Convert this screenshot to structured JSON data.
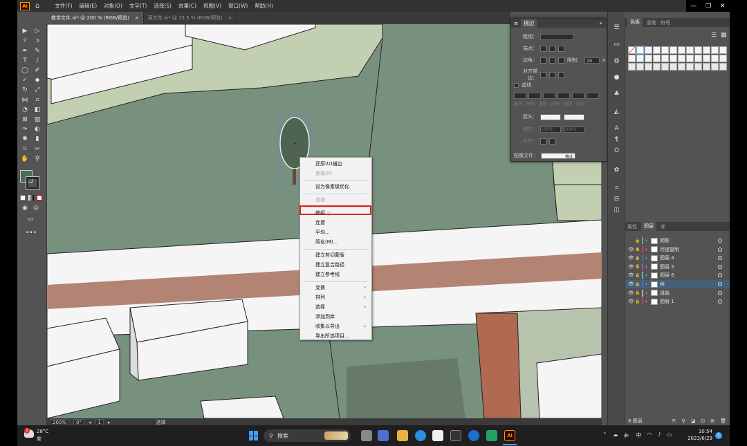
{
  "menubar": {
    "app_logo": "Ai",
    "menus": [
      "文件(F)",
      "编辑(E)",
      "对象(O)",
      "文字(T)",
      "选择(S)",
      "效果(C)",
      "视图(V)",
      "窗口(W)",
      "帮助(H)"
    ]
  },
  "tabs": [
    {
      "label": "教学文件.ai* @ 200 % (RGB/预览)",
      "close": "×"
    },
    {
      "label": "源文件.ai* @ 12.5 % (RGB/预览)",
      "close": "×"
    }
  ],
  "stroke_panel": {
    "title": "描边",
    "weight_label": "粗细：",
    "cap_label": "端点：",
    "corner_label": "边角：",
    "limit_label": "限制：",
    "limit_value": "10",
    "limit_unit": "x",
    "align_label": "对齐描边：",
    "dashed_label": "虚线",
    "dash_labels": [
      "虚线",
      "间隙",
      "虚线",
      "间隙",
      "虚线",
      "间隙"
    ],
    "arrow_label": "箭头：",
    "scale_label": "缩放：",
    "scale_values": [
      "100%",
      "100%"
    ],
    "align2_label": "对齐：",
    "profile_label": "配置文件：",
    "profile_value": "等比"
  },
  "swatches_panel": {
    "tabs": [
      "色板",
      "画笔",
      "符号"
    ]
  },
  "layers_panel": {
    "tabs": [
      "属性",
      "图层",
      "库"
    ],
    "layers": [
      {
        "name": "阴影",
        "color": "#4ec04e",
        "visible": false,
        "selected": false
      },
      {
        "name": "河道复制",
        "color": "#d04040",
        "visible": true,
        "selected": false
      },
      {
        "name": "图层 4",
        "color": "#4a6cd8",
        "visible": true,
        "selected": false
      },
      {
        "name": "图层 5",
        "color": "#c040c0",
        "visible": true,
        "selected": false
      },
      {
        "name": "图层 6",
        "color": "#4fb8c8",
        "visible": true,
        "selected": false
      },
      {
        "name": "树",
        "color": "#4a6cd8",
        "visible": true,
        "selected": true
      },
      {
        "name": "道路",
        "color": "#b0b0b0",
        "visible": true,
        "selected": false
      },
      {
        "name": "图层 1",
        "color": "#d04040",
        "visible": true,
        "selected": false
      }
    ],
    "count_label": "8 图层"
  },
  "context_menu": {
    "items": [
      {
        "label": "还原(U)描边",
        "disabled": false,
        "submenu": false
      },
      {
        "label": "重做(R)",
        "disabled": true,
        "submenu": false
      },
      {
        "sep": true
      },
      {
        "label": "设为像素级优化",
        "disabled": false,
        "submenu": false
      },
      {
        "sep": true
      },
      {
        "label": "透视",
        "disabled": true,
        "submenu": true
      },
      {
        "sep": true
      },
      {
        "label": "编组",
        "disabled": false,
        "submenu": false,
        "highlight": true
      },
      {
        "label": "连接",
        "disabled": false,
        "submenu": false
      },
      {
        "label": "平均...",
        "disabled": false,
        "submenu": false
      },
      {
        "label": "简化(M)...",
        "disabled": false,
        "submenu": false
      },
      {
        "sep": true
      },
      {
        "label": "建立剪切蒙版",
        "disabled": false,
        "submenu": false
      },
      {
        "label": "建立复合路径",
        "disabled": false,
        "submenu": false
      },
      {
        "label": "建立参考线",
        "disabled": false,
        "submenu": false
      },
      {
        "sep": true
      },
      {
        "label": "变换",
        "disabled": false,
        "submenu": true
      },
      {
        "label": "排列",
        "disabled": false,
        "submenu": true
      },
      {
        "label": "选择",
        "disabled": false,
        "submenu": true
      },
      {
        "label": "添加到库",
        "disabled": false,
        "submenu": false
      },
      {
        "label": "收集以导出",
        "disabled": false,
        "submenu": true
      },
      {
        "label": "导出所选项目...",
        "disabled": false,
        "submenu": false
      }
    ]
  },
  "status_bar": {
    "zoom": "200%",
    "rotation": "0°",
    "artboard": "1",
    "tool": "选择"
  },
  "taskbar": {
    "weather_temp": "28°C",
    "weather_desc": "雾",
    "weather_badge": "1",
    "search_label": "搜索",
    "ime": "中",
    "time": "10:54",
    "date": "2023/6/29",
    "notif_badge": "1",
    "active_app": "Ai"
  },
  "colors": {
    "canvas_green": "#78907e",
    "light_green": "#c3cfb1",
    "road": "#f4f4f4",
    "river": "#b38373",
    "highlight": "#e02020"
  }
}
